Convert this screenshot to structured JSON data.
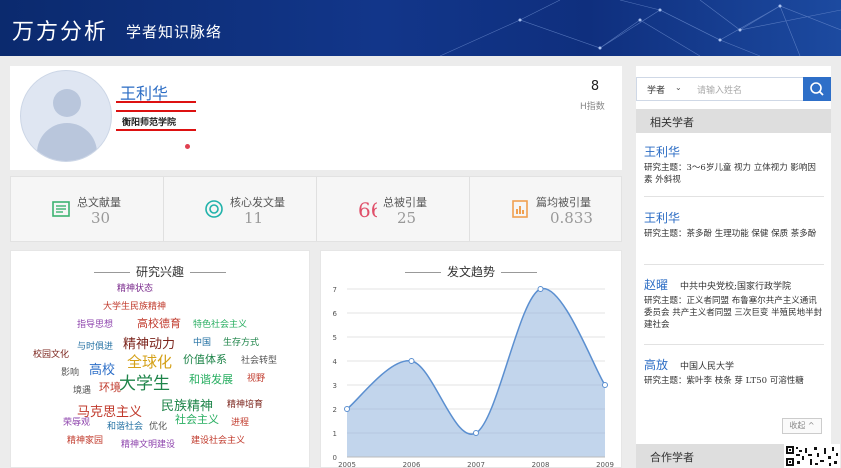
{
  "header": {
    "brand": "万方分析",
    "subtitle": "学者知识脉络"
  },
  "profile": {
    "name": "王利华",
    "affiliation": "衡阳师范学院",
    "h_index_value": "8",
    "h_index_label": "H指数"
  },
  "stats": [
    {
      "label": "总文献量",
      "value": "30",
      "icon": "document-icon",
      "color": "#3cb371"
    },
    {
      "label": "核心发文量",
      "value": "11",
      "icon": "target-icon",
      "color": "#20b2aa"
    },
    {
      "label": "总被引量",
      "value": "25",
      "icon": "quote-icon",
      "color": "#e0506a"
    },
    {
      "label": "篇均被引量",
      "value": "0.833",
      "icon": "chart-doc-icon",
      "color": "#f0a050"
    }
  ],
  "interests": {
    "title": "研究兴趣",
    "words": [
      {
        "text": "精神状态",
        "color": "#7a2a8c",
        "size": 9
      },
      {
        "text": "大学生民族精神",
        "color": "#c0392b",
        "size": 9
      },
      {
        "text": "指导思想",
        "color": "#8e44ad",
        "size": 9
      },
      {
        "text": "高校德育",
        "color": "#c0392b",
        "size": 11
      },
      {
        "text": "特色社会主义",
        "color": "#27ae60",
        "size": 9
      },
      {
        "text": "精神动力",
        "color": "#7b241c",
        "size": 13
      },
      {
        "text": "中国",
        "color": "#2471a3",
        "size": 9
      },
      {
        "text": "生存方式",
        "color": "#1e8449",
        "size": 9
      },
      {
        "text": "与时俱进",
        "color": "#2471a3",
        "size": 9
      },
      {
        "text": "全球化",
        "color": "#d4a017",
        "size": 15
      },
      {
        "text": "价值体系",
        "color": "#1e8449",
        "size": 11
      },
      {
        "text": "社会转型",
        "color": "#555555",
        "size": 9
      },
      {
        "text": "校园文化",
        "color": "#7b241c",
        "size": 9
      },
      {
        "text": "高校",
        "color": "#2e6fc8",
        "size": 13
      },
      {
        "text": "影响",
        "color": "#555555",
        "size": 9
      },
      {
        "text": "大学生",
        "color": "#1e8449",
        "size": 17
      },
      {
        "text": "和谐发展",
        "color": "#27ae60",
        "size": 11
      },
      {
        "text": "视野",
        "color": "#c0392b",
        "size": 9
      },
      {
        "text": "境遇",
        "color": "#555555",
        "size": 9
      },
      {
        "text": "环境",
        "color": "#c0392b",
        "size": 11
      },
      {
        "text": "民族精神",
        "color": "#1e8449",
        "size": 13
      },
      {
        "text": "精神培育",
        "color": "#7b241c",
        "size": 9
      },
      {
        "text": "马克思主义",
        "color": "#c0392b",
        "size": 13
      },
      {
        "text": "社会主义",
        "color": "#27ae60",
        "size": 11
      },
      {
        "text": "荣辱观",
        "color": "#8e44ad",
        "size": 9
      },
      {
        "text": "和谐社会",
        "color": "#2471a3",
        "size": 9
      },
      {
        "text": "优化",
        "color": "#555555",
        "size": 9
      },
      {
        "text": "进程",
        "color": "#c0392b",
        "size": 9
      },
      {
        "text": "精神家园",
        "color": "#c0392b",
        "size": 9
      },
      {
        "text": "精神文明建设",
        "color": "#8e44ad",
        "size": 9
      },
      {
        "text": "建设社会主义",
        "color": "#c0392b",
        "size": 9
      }
    ]
  },
  "trend": {
    "title": "发文趋势"
  },
  "chart_data": {
    "type": "area",
    "title": "发文趋势",
    "x": [
      "2005",
      "2006",
      "2007",
      "2008",
      "2009"
    ],
    "values": [
      2,
      4,
      1,
      7,
      3
    ],
    "ylim": [
      0,
      7
    ],
    "yticks": [
      "0",
      "1",
      "2",
      "3",
      "4",
      "5",
      "6",
      "7"
    ],
    "grid": true,
    "color": "#8fb3dc"
  },
  "sidebar": {
    "search_type": "学者",
    "search_placeholder": "请输入姓名",
    "related_title": "相关学者",
    "scholars": [
      {
        "name": "王利华",
        "inst": "",
        "topics": "研究主题：3～6岁儿童 视力 立体视力 影响因素 外斜视"
      },
      {
        "name": "王利华",
        "inst": "",
        "topics": "研究主题：茶多酚 生理功能 保健 保质 茶多酚"
      },
      {
        "name": "赵曜",
        "inst": "中共中央党校;国家行政学院",
        "topics": "研究主题：正义者同盟 布鲁塞尔共产主义通讯委员会 共产主义者同盟 三次巨变 半殖民地半封建社会"
      },
      {
        "name": "高放",
        "inst": "中国人民大学",
        "topics": "研究主题：紫叶李 枝条 芽 LT50 可溶性糖"
      }
    ],
    "coop_title": "合作学者",
    "collapse_label": "收起 ^"
  }
}
